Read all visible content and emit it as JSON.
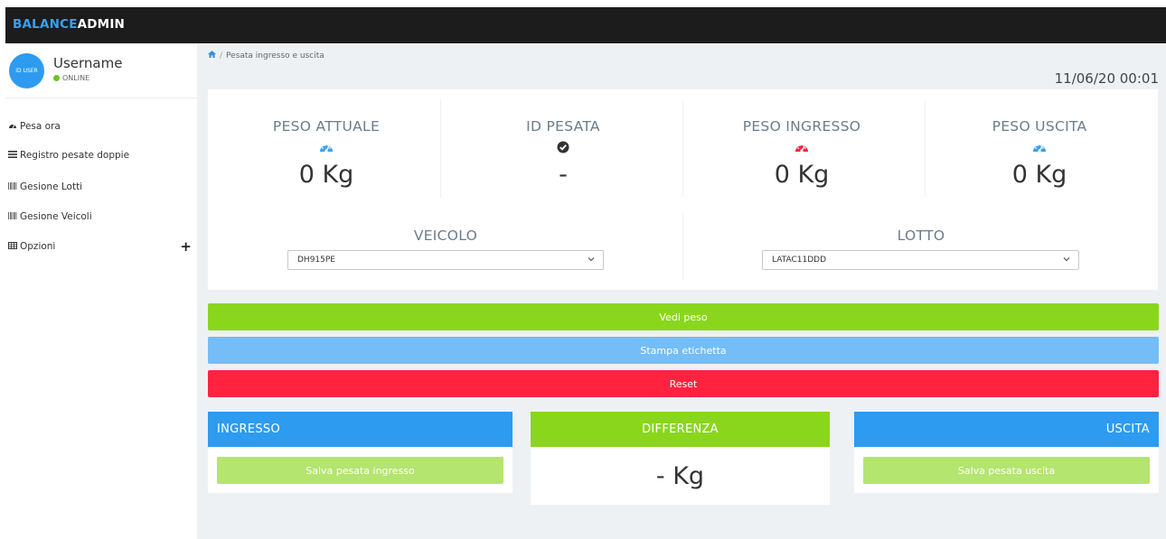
{
  "app": {
    "brand_part1": "BALANCE",
    "brand_part2": "ADMIN"
  },
  "user": {
    "name": "Username",
    "status": "ONLINE",
    "avatar_text": "ID USER"
  },
  "sidebar": {
    "items": [
      {
        "label": "Pesa ora",
        "icon": "dashboard-icon"
      },
      {
        "label": "Registro pesate doppie",
        "icon": "list-icon"
      },
      {
        "label": "Gesione Lotti",
        "icon": "barcode-icon"
      },
      {
        "label": "Gesione Veicoli",
        "icon": "barcode-icon"
      },
      {
        "label": "Opzioni",
        "icon": "table-icon",
        "expand": "+"
      }
    ]
  },
  "breadcrumb": {
    "current": "Pesata ingresso e uscita",
    "separator": "/"
  },
  "datetime": "11/06/20 00:01",
  "stats": [
    {
      "label": "PESO ATTUALE",
      "value": "0 Kg",
      "icon": "gauge-icon",
      "icon_color": "#3aa0f2"
    },
    {
      "label": "ID PESATA",
      "value": "-",
      "icon": "check-circle-icon",
      "icon_color": "#333333"
    },
    {
      "label": "PESO INGRESSO",
      "value": "0 Kg",
      "icon": "gauge-icon",
      "icon_color": "#f0293f"
    },
    {
      "label": "PESO USCITA",
      "value": "0 Kg",
      "icon": "gauge-icon",
      "icon_color": "#3aa0f2"
    }
  ],
  "veicolo": {
    "label": "VEICOLO",
    "selected": "DH915PE"
  },
  "lotto": {
    "label": "LOTTO",
    "selected": "LATAC11DDD"
  },
  "actions": {
    "vedi_peso": "Vedi peso",
    "stampa_etichetta": "Stampa etichetta",
    "reset": "Reset"
  },
  "ingresso": {
    "title": "INGRESSO",
    "button": "Salva pesata ingresso"
  },
  "differenza": {
    "title": "DIFFERENZA",
    "value": "- Kg"
  },
  "uscita": {
    "title": "USCITA",
    "button": "Salva pesata uscita"
  },
  "colors": {
    "green": "#8ad61d",
    "blue_light": "#74bdf6",
    "red": "#ff2340",
    "blue": "#2d9bf0",
    "save_green": "#b4e56f"
  }
}
